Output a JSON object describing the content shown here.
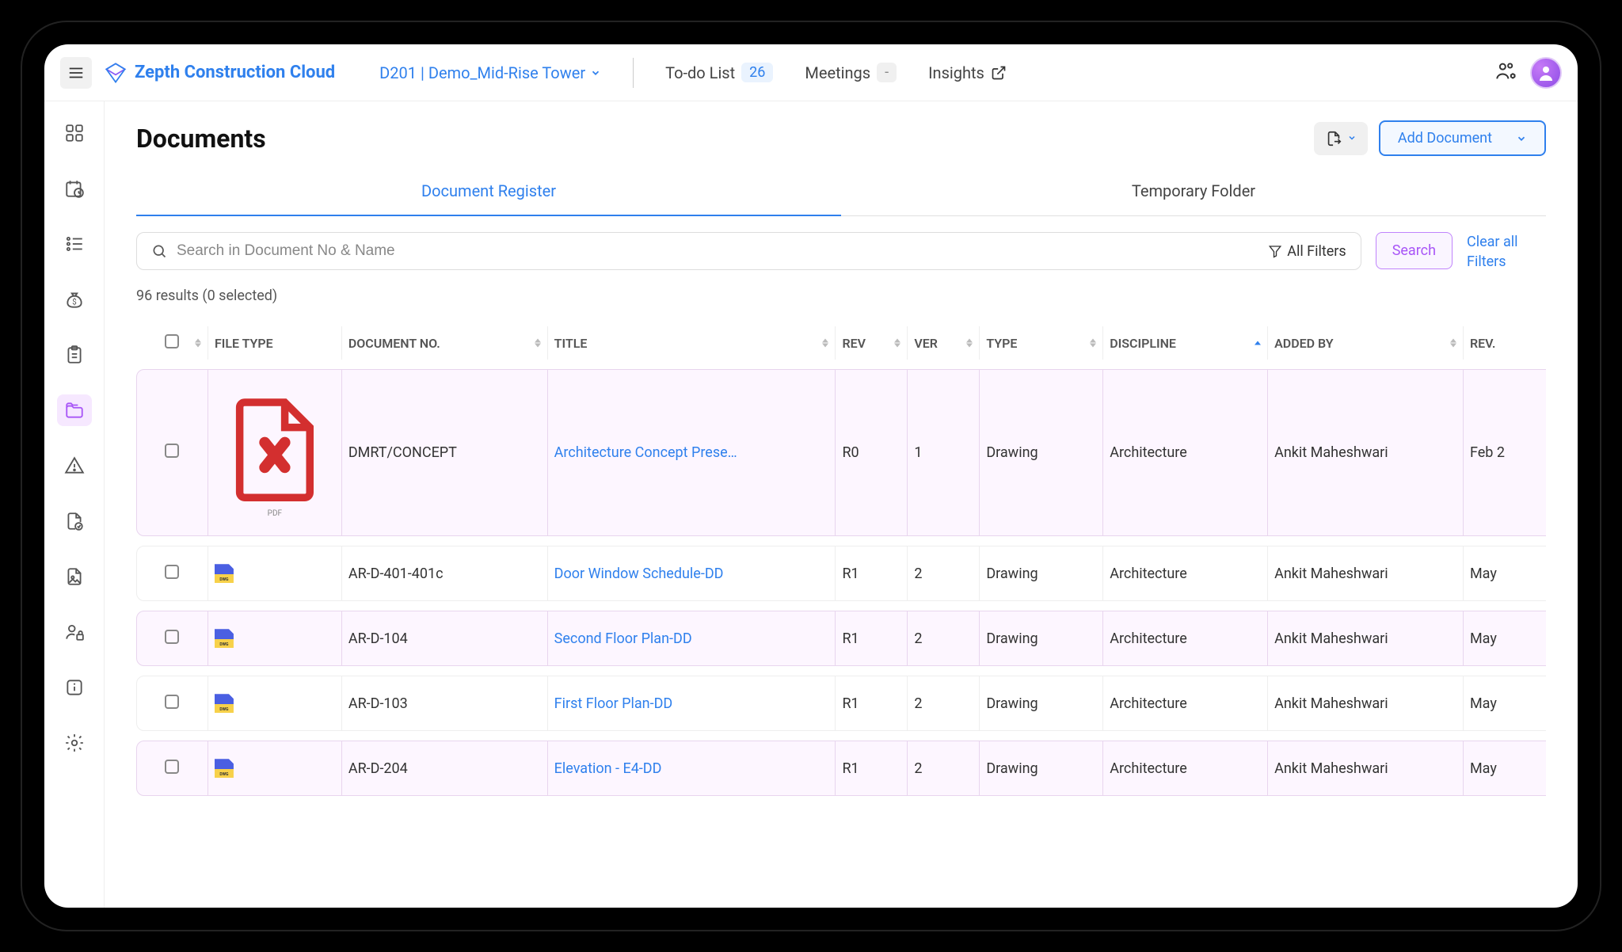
{
  "header": {
    "app_name": "Zepth Construction Cloud",
    "project": "D201 | Demo_Mid-Rise Tower",
    "todo_label": "To-do List",
    "todo_count": "26",
    "meetings_label": "Meetings",
    "meetings_count": "-",
    "insights_label": "Insights"
  },
  "page": {
    "title": "Documents",
    "add_document": "Add Document"
  },
  "tabs": {
    "register": "Document Register",
    "temp": "Temporary Folder"
  },
  "search": {
    "placeholder": "Search in Document No & Name",
    "all_filters": "All Filters",
    "search_btn": "Search",
    "clear": "Clear all Filters"
  },
  "results_summary": "96 results (0 selected)",
  "columns": {
    "file_type": "FILE TYPE",
    "doc_no": "DOCUMENT NO.",
    "title": "TITLE",
    "rev": "REV",
    "ver": "VER",
    "type": "TYPE",
    "discipline": "DISCIPLINE",
    "added_by": "ADDED BY",
    "rev_date": "REV."
  },
  "rows": [
    {
      "ft": "pdf",
      "docno": "DMRT/CONCEPT",
      "title": "Architecture Concept Prese…",
      "rev": "R0",
      "ver": "1",
      "type": "Drawing",
      "disc": "Architecture",
      "by": "Ankit Maheshwari",
      "date": "Feb 2"
    },
    {
      "ft": "dwg",
      "docno": "AR-D-401-401c",
      "title": "Door Window Schedule-DD",
      "rev": "R1",
      "ver": "2",
      "type": "Drawing",
      "disc": "Architecture",
      "by": "Ankit Maheshwari",
      "date": "May"
    },
    {
      "ft": "dwg",
      "docno": "AR-D-104",
      "title": "Second Floor Plan-DD",
      "rev": "R1",
      "ver": "2",
      "type": "Drawing",
      "disc": "Architecture",
      "by": "Ankit Maheshwari",
      "date": "May"
    },
    {
      "ft": "dwg",
      "docno": "AR-D-103",
      "title": "First Floor Plan-DD",
      "rev": "R1",
      "ver": "2",
      "type": "Drawing",
      "disc": "Architecture",
      "by": "Ankit Maheshwari",
      "date": "May"
    },
    {
      "ft": "dwg",
      "docno": "AR-D-204",
      "title": "Elevation - E4-DD",
      "rev": "R1",
      "ver": "2",
      "type": "Drawing",
      "disc": "Architecture",
      "by": "Ankit Maheshwari",
      "date": "May"
    }
  ]
}
